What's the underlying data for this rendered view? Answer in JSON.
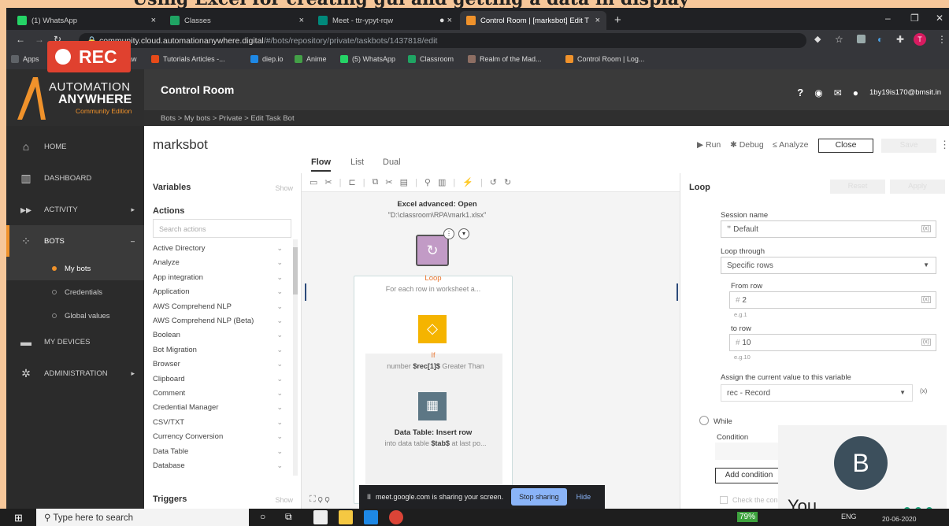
{
  "slide_title": "Using Excel for creating gui and getting a data in display",
  "browser": {
    "tabs": [
      {
        "label": "(1) WhatsApp",
        "color": "#25d366"
      },
      {
        "label": "Classes",
        "color": "#1fa463"
      },
      {
        "label": "Meet - ttr-ypyt-rqw",
        "color": "#00897b"
      },
      {
        "label": "Control Room | [marksbot] Edit T",
        "color": "#f0922b"
      }
    ],
    "url_host": "community.cloud.automationanywhere.digital",
    "url_path": "/#/bots/repository/private/taskbots/1437818/edit",
    "bookmarks": [
      {
        "label": "Apps",
        "color": "#5f6368"
      },
      {
        "label": "draw",
        "color": "#f9a825"
      },
      {
        "label": "Tutorials Articles -...",
        "color": "#e64a19"
      },
      {
        "label": "diep.io",
        "color": "#1e88e5"
      },
      {
        "label": "Anime",
        "color": "#43a047"
      },
      {
        "label": "(5) WhatsApp",
        "color": "#25d366"
      },
      {
        "label": "Classroom",
        "color": "#1fa463"
      },
      {
        "label": "Realm of the Mad...",
        "color": "#8d6e63"
      },
      {
        "label": "Control Room | Log...",
        "color": "#f0922b"
      }
    ]
  },
  "rec_label": "REC",
  "sidebar": {
    "logo_line1": "AUTOMATION",
    "logo_line2": "ANYWHERE",
    "logo_line3": "Community Edition",
    "items": [
      {
        "label": "HOME",
        "icon": "home-icon"
      },
      {
        "label": "DASHBOARD",
        "icon": "dashboard-icon"
      },
      {
        "label": "ACTIVITY",
        "icon": "activity-icon"
      },
      {
        "label": "BOTS",
        "icon": "bots-icon"
      },
      {
        "label": "MY DEVICES",
        "icon": "devices-icon"
      },
      {
        "label": "ADMINISTRATION",
        "icon": "admin-icon"
      }
    ],
    "bots_sub": [
      "My bots",
      "Credentials",
      "Global values"
    ]
  },
  "header": {
    "title": "Control Room",
    "user": "1by19is170@bmsit.in"
  },
  "breadcrumb": "Bots > My bots > Private > Edit Task Bot",
  "bot": {
    "name": "marksbot",
    "run": "Run",
    "debug": "Debug",
    "analyze": "Analyze",
    "close": "Close",
    "save": "Save"
  },
  "view_tabs": [
    "Flow",
    "List",
    "Dual"
  ],
  "left_panel": {
    "variables": "Variables",
    "show": "Show",
    "actions": "Actions",
    "search_placeholder": "Search actions",
    "action_list": [
      "Active Directory",
      "Analyze",
      "App integration",
      "Application",
      "AWS Comprehend NLP",
      "AWS Comprehend NLP (Beta)",
      "Boolean",
      "Bot Migration",
      "Browser",
      "Clipboard",
      "Comment",
      "Credential Manager",
      "CSV/TXT",
      "Currency Conversion",
      "Data Table",
      "Database"
    ],
    "triggers": "Triggers"
  },
  "flow": {
    "excel_title": "Excel advanced: Open",
    "excel_path": "\"D:\\classroom\\RPA\\mark1.xlsx\"",
    "loop_title": "Loop",
    "loop_desc": "For each row in worksheet a...",
    "if_title": "If",
    "if_desc_prefix": "number ",
    "if_var": "$rec[1]$",
    "if_desc_suffix": " Greater Than",
    "dt_title": "Data Table: Insert row",
    "dt_desc_prefix": "into data table ",
    "dt_var": "$tab$",
    "dt_desc_suffix": " at last po..."
  },
  "right_panel": {
    "title": "Loop",
    "reset": "Reset",
    "apply": "Apply",
    "session_label": "Session name",
    "session_value": "Default",
    "loop_through_label": "Loop through",
    "loop_through_value": "Specific rows",
    "from_row_label": "From row",
    "from_row_value": "2",
    "from_row_eg": "e.g.1",
    "to_row_label": "to row",
    "to_row_value": "10",
    "to_row_eg": "e.g.10",
    "assign_label": "Assign the current value to this variable",
    "assign_value": "rec - Record",
    "while_label": "While",
    "condition_label": "Condition",
    "add_condition": "Add condition",
    "check_label": "Check the con"
  },
  "meet": {
    "avatar_letter": "B",
    "you": "You"
  },
  "share_bar": {
    "text": "meet.google.com is sharing your screen.",
    "stop": "Stop sharing",
    "hide": "Hide"
  },
  "taskbar": {
    "search": "Type here to search",
    "battery": "79%",
    "lang": "ENG",
    "date": "20-06-2020"
  }
}
